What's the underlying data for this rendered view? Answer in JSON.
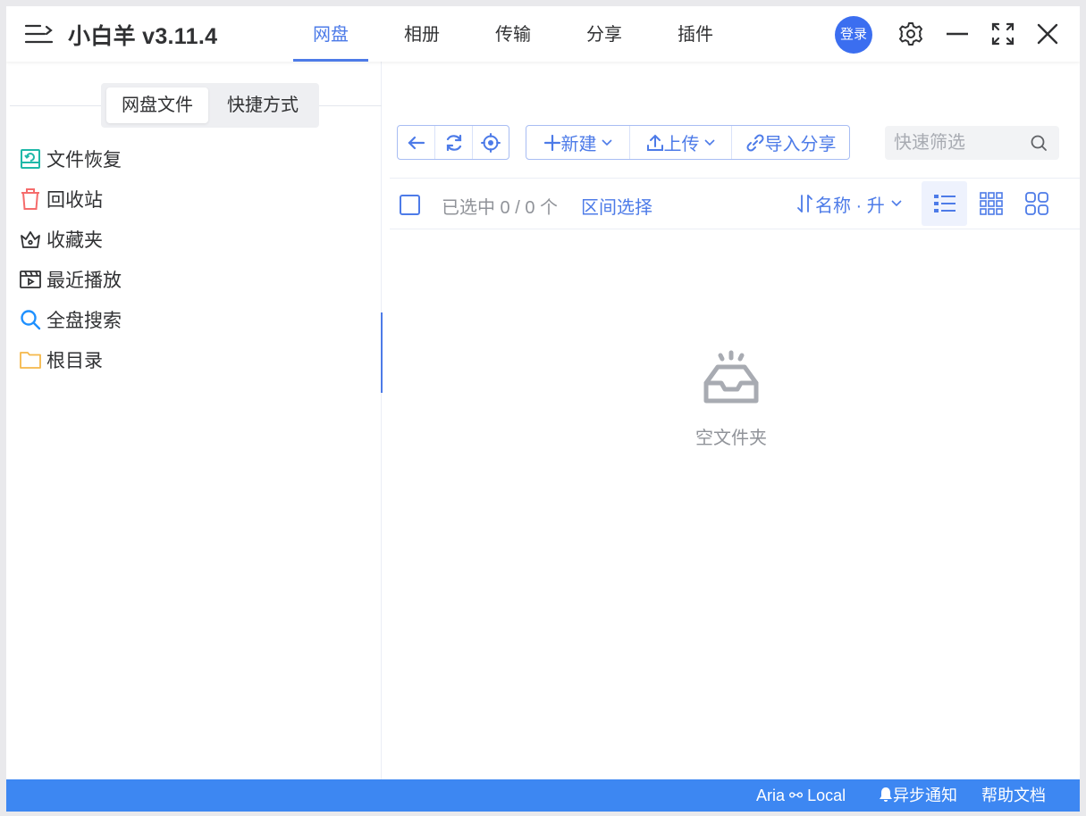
{
  "app": {
    "title": "小白羊 v3.11.4",
    "accent_color": "#4d7be8",
    "login_color": "#3b6ef0",
    "statusbar_color": "#3d87f2"
  },
  "header": {
    "tabs": [
      {
        "label": "网盘",
        "active": true
      },
      {
        "label": "相册",
        "active": false
      },
      {
        "label": "传输",
        "active": false
      },
      {
        "label": "分享",
        "active": false
      },
      {
        "label": "插件",
        "active": false
      }
    ],
    "login_label": "登录",
    "icons": [
      "menu-icon",
      "settings-gear-icon",
      "minimize-icon",
      "fullscreen-icon",
      "close-icon"
    ]
  },
  "sidebar": {
    "segments": [
      {
        "label": "网盘文件",
        "active": true
      },
      {
        "label": "快捷方式",
        "active": false
      }
    ],
    "items": [
      {
        "label": "文件恢复",
        "icon": "file-recover-icon",
        "color": "#1fb8a8"
      },
      {
        "label": "回收站",
        "icon": "trash-icon",
        "color": "#f56c6c"
      },
      {
        "label": "收藏夹",
        "icon": "crown-icon",
        "color": "#303133"
      },
      {
        "label": "最近播放",
        "icon": "video-play-icon",
        "color": "#303133"
      },
      {
        "label": "全盘搜索",
        "icon": "search-icon",
        "color": "#1e90ff"
      },
      {
        "label": "根目录",
        "icon": "folder-icon",
        "color": "#f5b84a"
      }
    ]
  },
  "toolbar": {
    "new_label": "新建",
    "upload_label": "上传",
    "import_share_label": "导入分享",
    "filter_placeholder": "快速筛选"
  },
  "selection": {
    "text": "已选中 0 / 0 个",
    "range_select_label": "区间选择",
    "sort_label": "名称 · 升"
  },
  "content": {
    "empty_text": "空文件夹"
  },
  "statusbar": {
    "aria_label": "Aria ⚯ Local",
    "notify_label": "异步通知",
    "help_label": "帮助文档"
  }
}
